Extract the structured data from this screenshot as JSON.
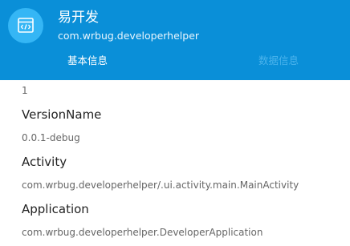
{
  "header": {
    "app_name": "易开发",
    "package_name": "com.wrbug.developerhelper",
    "icon": "code-window-icon",
    "background_color": "#0a8fd8",
    "icon_background_color": "#35b6f5"
  },
  "tabs": [
    {
      "label": "基本信息",
      "selected": true
    },
    {
      "label": "数据信息",
      "selected": false
    }
  ],
  "info": {
    "version_code_value": "1",
    "version_name_label": "VersionName",
    "version_name_value": "0.0.1-debug",
    "activity_label": "Activity",
    "activity_value": "com.wrbug.developerhelper/.ui.activity.main.MainActivity",
    "application_label": "Application",
    "application_value": "com.wrbug.developerhelper.DeveloperApplication"
  }
}
